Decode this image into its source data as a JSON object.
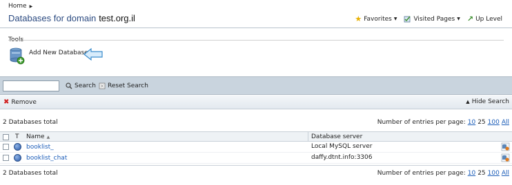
{
  "breadcrumb": {
    "home": "Home"
  },
  "header": {
    "title": "Databases for domain",
    "domain": "test.org.il"
  },
  "toplinks": {
    "favorites": "Favorites",
    "visited": "Visited Pages",
    "up": "Up Level"
  },
  "tools": {
    "label": "Tools",
    "add_database": "Add New Database"
  },
  "search": {
    "value": "",
    "search_label": "Search",
    "reset_label": "Reset Search"
  },
  "actions": {
    "remove": "Remove",
    "hide_search": "Hide Search"
  },
  "summary": {
    "total_top": "2 Databases total",
    "total_bottom": "2 Databases total",
    "per_page_label": "Number of entries per page:",
    "per_page_options": [
      "10",
      "25",
      "100",
      "All"
    ],
    "per_page_current": "25"
  },
  "table": {
    "columns": {
      "type": "T",
      "name": "Name",
      "server": "Database server"
    },
    "rows": [
      {
        "name": "booklist_",
        "server": "Local MySQL server"
      },
      {
        "name": "booklist_chat",
        "server": "daffy.dtnt.info:3306"
      }
    ]
  },
  "colors": {
    "title": "#2b4a80",
    "link": "#1a5cb8",
    "bar": "#c9d4de"
  },
  "icons": [
    "star-icon",
    "visited-pages-icon",
    "up-level-icon",
    "database-add-icon",
    "pointer-arrow-icon",
    "search-icon",
    "reset-icon",
    "remove-icon",
    "globe-icon",
    "db-action-icon"
  ]
}
